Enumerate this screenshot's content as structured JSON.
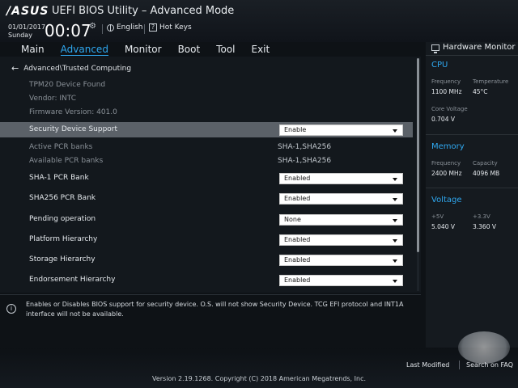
{
  "header": {
    "logo": "/ASUS",
    "title": "UEFI BIOS Utility – Advanced Mode",
    "date": "01/01/2017",
    "day": "Sunday",
    "time": "00:07",
    "language": "English",
    "hotkeys": "Hot Keys"
  },
  "menu": {
    "items": [
      "Main",
      "Advanced",
      "Monitor",
      "Boot",
      "Tool",
      "Exit"
    ],
    "active": "Advanced"
  },
  "breadcrumb": "Advanced\\Trusted Computing",
  "info": {
    "device": "TPM20 Device Found",
    "vendor": "Vendor: INTC",
    "firmware": "Firmware Version: 401.0"
  },
  "settings": [
    {
      "label": "Security Device Support",
      "value": "Enable"
    },
    {
      "label": "Active PCR banks",
      "value": "SHA-1,SHA256"
    },
    {
      "label": "Available PCR banks",
      "value": "SHA-1,SHA256"
    },
    {
      "label": "SHA-1 PCR Bank",
      "value": "Enabled"
    },
    {
      "label": "SHA256 PCR Bank",
      "value": "Enabled"
    },
    {
      "label": "Pending operation",
      "value": "None"
    },
    {
      "label": "Platform Hierarchy",
      "value": "Enabled"
    },
    {
      "label": "Storage Hierarchy",
      "value": "Enabled"
    },
    {
      "label": "Endorsement Hierarchy",
      "value": "Enabled"
    }
  ],
  "help_text": "Enables or Disables BIOS support for security device. O.S. will not show Security Device. TCG EFI protocol and INT1A interface will not be available.",
  "hardware_monitor": {
    "title": "Hardware Monitor",
    "cpu": {
      "heading": "CPU",
      "frequency_label": "Frequency",
      "frequency": "1100 MHz",
      "temperature_label": "Temperature",
      "temperature": "45°C",
      "core_voltage_label": "Core Voltage",
      "core_voltage": "0.704 V"
    },
    "memory": {
      "heading": "Memory",
      "frequency_label": "Frequency",
      "frequency": "2400 MHz",
      "capacity_label": "Capacity",
      "capacity": "4096 MB"
    },
    "voltage": {
      "heading": "Voltage",
      "v5_label": "+5V",
      "v5": "5.040 V",
      "v33_label": "+3.3V",
      "v33": "3.360 V"
    }
  },
  "footer": {
    "last_modified": "Last Modified",
    "search_faq": "Search on FAQ",
    "copyright": "Version 2.19.1268. Copyright (C) 2018 American Megatrends, Inc."
  },
  "colors": {
    "accent": "#2fa8f0",
    "highlight_row": "#5b6168",
    "background": "#13181d"
  }
}
